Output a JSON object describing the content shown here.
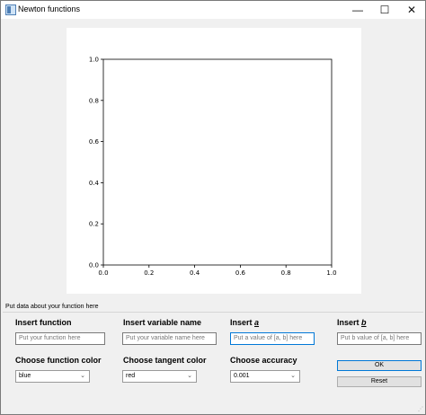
{
  "window": {
    "title": "Newton functions"
  },
  "title_controls": {
    "minimize": "—",
    "maximize": "☐",
    "close": "✕"
  },
  "chart_data": {
    "type": "line",
    "series": [],
    "xlim": [
      0.0,
      1.0
    ],
    "ylim": [
      0.0,
      1.0
    ],
    "x_ticks": [
      "0.0",
      "0.2",
      "0.4",
      "0.6",
      "0.8",
      "1.0"
    ],
    "y_ticks": [
      "0.0",
      "0.2",
      "0.4",
      "0.6",
      "0.8",
      "1.0"
    ],
    "grid": false,
    "title": "",
    "xlabel": "",
    "ylabel": ""
  },
  "form": {
    "group_title": "Put data about your function here",
    "insert_function": {
      "label": "Insert function",
      "placeholder": "Put your function here"
    },
    "insert_variable": {
      "label": "Insert variable name",
      "placeholder": "Put your variable name here"
    },
    "insert_a": {
      "label": "Insert ",
      "var": "a",
      "placeholder": "Put a value of [a, b] here"
    },
    "insert_b": {
      "label": "Insert ",
      "var": "b",
      "placeholder": "Put b value of [a, b] here"
    },
    "function_color": {
      "label": "Choose function color",
      "value": "blue"
    },
    "tangent_color": {
      "label": "Choose tangent color",
      "value": "red"
    },
    "accuracy": {
      "label": "Choose accuracy",
      "value": "0.001"
    },
    "ok_label": "OK",
    "reset_label": "Reset"
  }
}
